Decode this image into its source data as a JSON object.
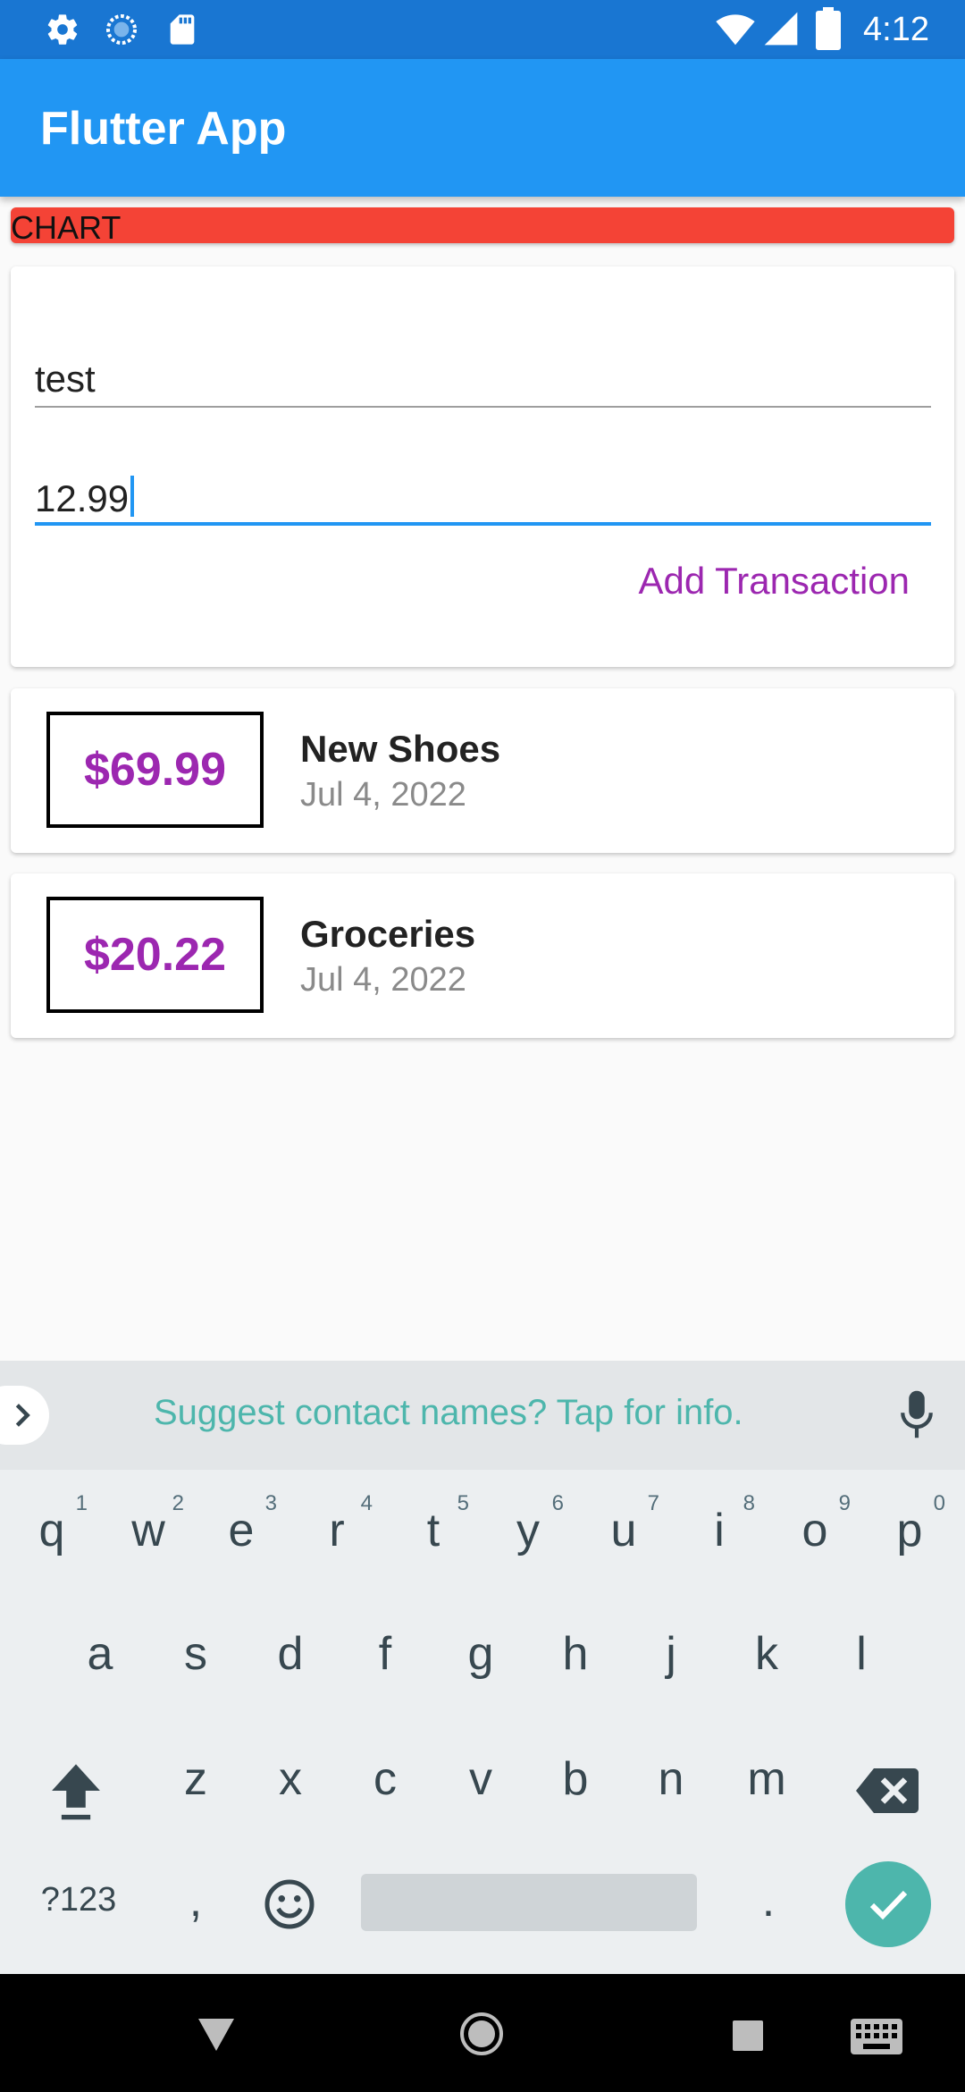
{
  "status_bar": {
    "time": "4:12"
  },
  "app_bar": {
    "title": "Flutter App"
  },
  "chart": {
    "label": "CHART"
  },
  "form": {
    "title_value": "test",
    "amount_value": "12.99",
    "submit_label": "Add Transaction"
  },
  "transactions": [
    {
      "amount": "$69.99",
      "title": "New Shoes",
      "date": "Jul 4, 2022"
    },
    {
      "amount": "$20.22",
      "title": "Groceries",
      "date": "Jul 4, 2022"
    }
  ],
  "keyboard": {
    "suggestion": "Suggest contact names? Tap for info.",
    "row1": [
      "q",
      "w",
      "e",
      "r",
      "t",
      "y",
      "u",
      "i",
      "o",
      "p"
    ],
    "row1_hints": [
      "1",
      "2",
      "3",
      "4",
      "5",
      "6",
      "7",
      "8",
      "9",
      "0"
    ],
    "row2": [
      "a",
      "s",
      "d",
      "f",
      "g",
      "h",
      "j",
      "k",
      "l"
    ],
    "row3": [
      "z",
      "x",
      "c",
      "v",
      "b",
      "n",
      "m"
    ],
    "symbols_label": "?123",
    "comma": ",",
    "period": "."
  },
  "colors": {
    "status_bar": "#1976d2",
    "app_bar": "#2196f3",
    "chart": "#f44336",
    "accent": "#9c27b0",
    "keyboard_accent": "#4db6ac"
  }
}
